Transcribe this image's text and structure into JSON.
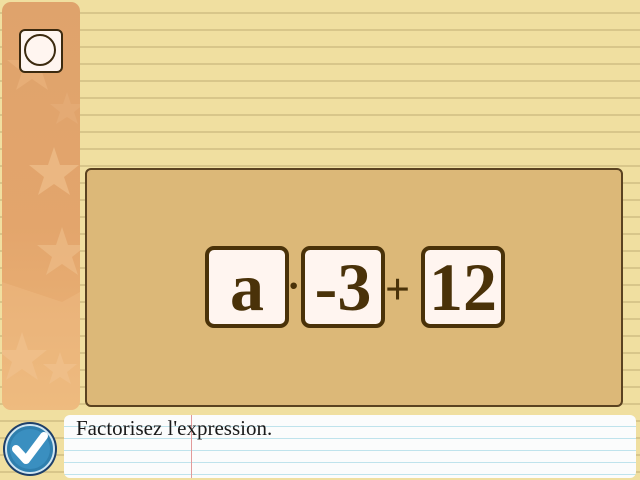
{
  "exercise": {
    "tiles": [
      "a",
      "-3",
      "12"
    ],
    "operators": [
      "·",
      "+"
    ]
  },
  "instruction": "Factorisez l'expression.",
  "icons": {
    "sidebar_button": "circle-icon",
    "submit_button": "checkmark-icon"
  },
  "colors": {
    "paper": "#f0dfa0",
    "sidebar": "#e3a56c",
    "board": "#dcb878",
    "tile_border": "#4a3209",
    "submit": "#1d3f6a"
  }
}
